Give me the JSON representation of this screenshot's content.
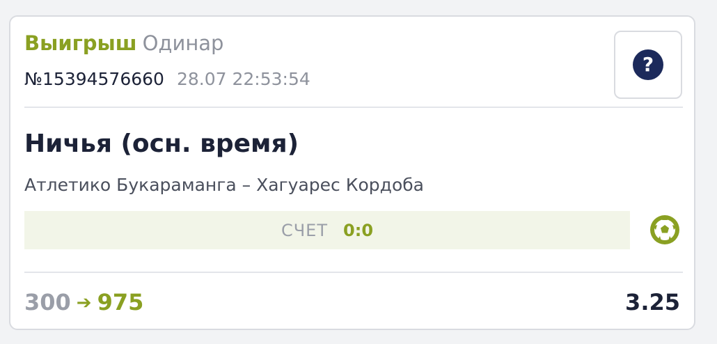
{
  "bet": {
    "status": "Выигрыш",
    "type": "Одинар",
    "number": "№15394576660",
    "datetime": "28.07 22:53:54",
    "help_label": "?"
  },
  "event": {
    "outcome": "Ничья (осн. время)",
    "match": "Атлетико Букараманга – Хагуарес Кордоба",
    "score_label": "СЧЕТ",
    "score": "0:0",
    "sport_icon": "football-icon"
  },
  "totals": {
    "stake": "300",
    "arrow": "➔",
    "payout": "975",
    "odds": "3.25"
  },
  "colors": {
    "win_green": "#8aa022",
    "dark_navy": "#1c2237",
    "help_navy": "#1c2a5b",
    "muted_gray": "#8e929c",
    "score_bg": "#f2f5e8"
  }
}
